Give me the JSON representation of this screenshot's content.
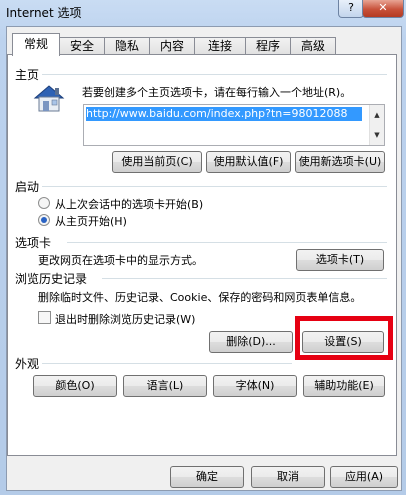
{
  "window": {
    "title": "Internet 选项",
    "help_label": "?",
    "close_label": "✕"
  },
  "tabs": [
    "常规",
    "安全",
    "隐私",
    "内容",
    "连接",
    "程序",
    "高级"
  ],
  "home": {
    "group_label": "主页",
    "instruction": "若要创建多个主页选项卡，请在每行输入一个地址(R)。",
    "url": "http://www.baidu.com/index.php?tn=98012088",
    "buttons": [
      "使用当前页(C)",
      "使用默认值(F)",
      "使用新选项卡(U)"
    ]
  },
  "startup": {
    "group_label": "启动",
    "options": [
      {
        "label": "从上次会话中的选项卡开始(B)",
        "selected": false
      },
      {
        "label": "从主页开始(H)",
        "selected": true
      }
    ]
  },
  "tabs_section": {
    "group_label": "选项卡",
    "description": "更改网页在选项卡中的显示方式。",
    "button": "选项卡(T)"
  },
  "history": {
    "group_label": "浏览历史记录",
    "description": "删除临时文件、历史记录、Cookie、保存的密码和网页表单信息。",
    "checkbox_label": "退出时删除浏览历史记录(W)",
    "delete_button": "删除(D)...",
    "settings_button": "设置(S)"
  },
  "appearance": {
    "group_label": "外观",
    "buttons": [
      "颜色(O)",
      "语言(L)",
      "字体(N)",
      "辅助功能(E)"
    ]
  },
  "footer": {
    "ok": "确定",
    "cancel": "取消",
    "apply": "应用(A)"
  },
  "colors": {
    "highlight": "#e60012",
    "selection": "#3399ff"
  },
  "icons": [
    "house-icon",
    "help-icon",
    "close-icon"
  ]
}
